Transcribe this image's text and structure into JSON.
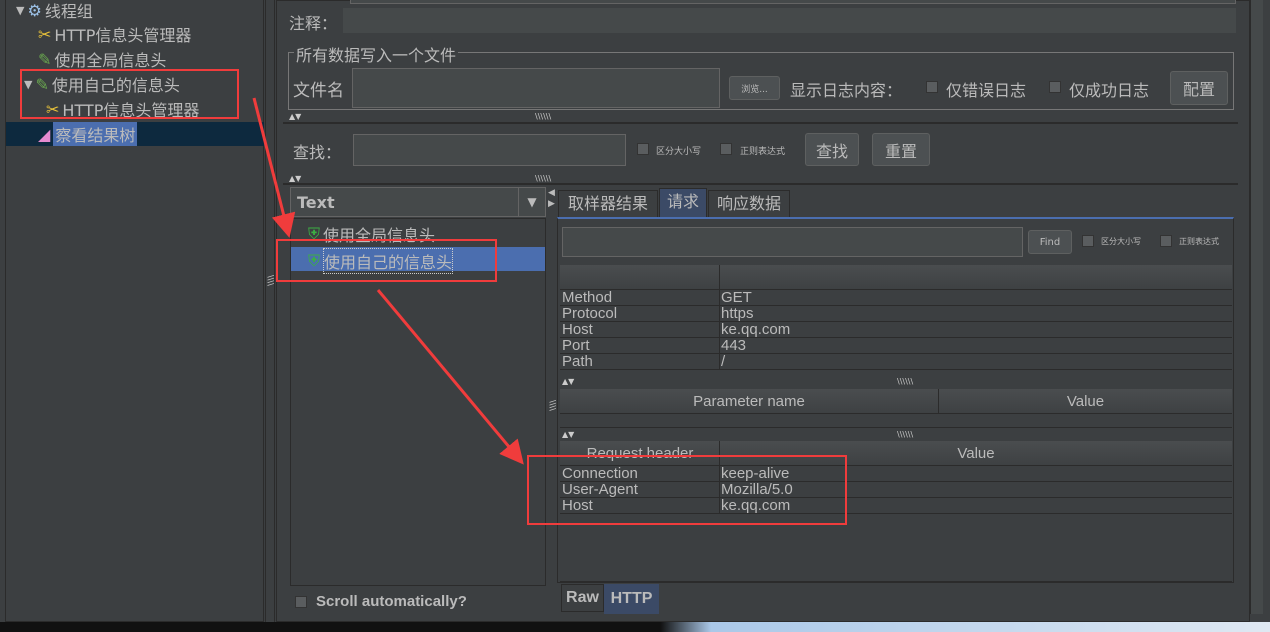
{
  "tree": {
    "items": [
      {
        "label": "线程组",
        "icon": "gear-icon"
      },
      {
        "label": "HTTP信息头管理器",
        "icon": "wrench-icon"
      },
      {
        "label": "使用全局信息头",
        "icon": "pipette-icon"
      },
      {
        "label": "使用自己的信息头",
        "icon": "pipette-icon"
      },
      {
        "label": "HTTP信息头管理器",
        "icon": "wrench-icon"
      },
      {
        "label": "察看结果树",
        "icon": "chart-icon"
      }
    ]
  },
  "form": {
    "comment_label": "注释：",
    "file_group_title": "所有数据写入一个文件",
    "filename_label": "文件名",
    "browse_label": "浏览...",
    "log_label": "显示日志内容：",
    "errors_only": "仅错误日志",
    "success_only": "仅成功日志",
    "config_label": "配置"
  },
  "search": {
    "label": "查找：",
    "case_label": "区分大小写",
    "regex_label": "正则表达式",
    "find_label": "查找",
    "reset_label": "重置"
  },
  "results": {
    "renderer": "Text",
    "items": [
      "使用全局信息头",
      "使用自己的信息头"
    ],
    "scroll_label": "Scroll automatically?"
  },
  "detail": {
    "tabs": [
      "取样器结果",
      "请求",
      "响应数据"
    ],
    "find_label": "Find",
    "case_label": "区分大小写",
    "regex_label": "正则表达式",
    "request_rows": [
      [
        "Method",
        "GET"
      ],
      [
        "Protocol",
        "https"
      ],
      [
        "Host",
        "ke.qq.com"
      ],
      [
        "Port",
        "443"
      ],
      [
        "Path",
        "/"
      ]
    ],
    "param_headers": [
      "Parameter name",
      "Value"
    ],
    "header_headers": [
      "Request header",
      "Value"
    ],
    "header_rows": [
      [
        "Connection",
        "keep-alive"
      ],
      [
        "User-Agent",
        "Mozilla/5.0"
      ],
      [
        "Host",
        "ke.qq.com"
      ]
    ],
    "bottom_tabs": [
      "Raw",
      "HTTP"
    ]
  },
  "colors": {
    "annotation": "#f03c3c",
    "selection": "#4b6eaf",
    "background": "#3c3f41"
  }
}
